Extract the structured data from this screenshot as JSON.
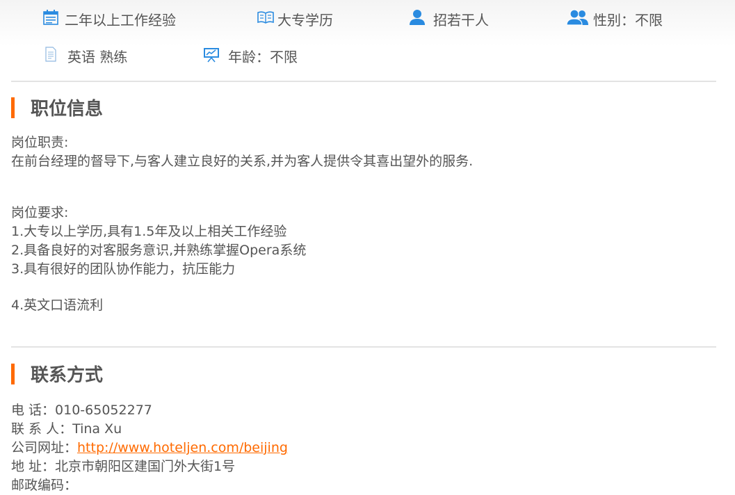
{
  "tags": {
    "experience": "二年以上工作经验",
    "education": "大专学历",
    "headcount": "招若干人",
    "gender": "性别：不限",
    "language": "英语 熟练",
    "age": "年龄：不限"
  },
  "job_section": {
    "title": "职位信息",
    "duties_label": "岗位职责:",
    "duties_text": "在前台经理的督导下,与客人建立良好的关系,并为客人提供令其喜出望外的服务.",
    "req_label": "岗位要求:",
    "req_items": [
      "1.大专以上学历,具有1.5年及以上相关工作经验",
      "2.具备良好的对客服务意识,并熟练掌握Opera系统",
      "3.具有很好的团队协作能力，抗压能力",
      "4.英文口语流利"
    ]
  },
  "contact_section": {
    "title": "联系方式",
    "phone_label": "电 话：",
    "phone": "010-65052277",
    "contact_label": "联 系 人：",
    "contact": "Tina Xu",
    "website_label": "公司网址：",
    "website": "http://www.hoteljen.com/beijing",
    "address_label": "地 址：",
    "address": "北京市朝阳区建国门外大街1号",
    "postcode_label": "邮政编码："
  },
  "colors": {
    "accent": "#ff6a00",
    "icon_blue": "#2a8be0",
    "text": "#555555"
  },
  "icons": [
    "calendar-icon",
    "book-icon",
    "user-icon",
    "users-icon",
    "document-icon",
    "presentation-icon"
  ]
}
